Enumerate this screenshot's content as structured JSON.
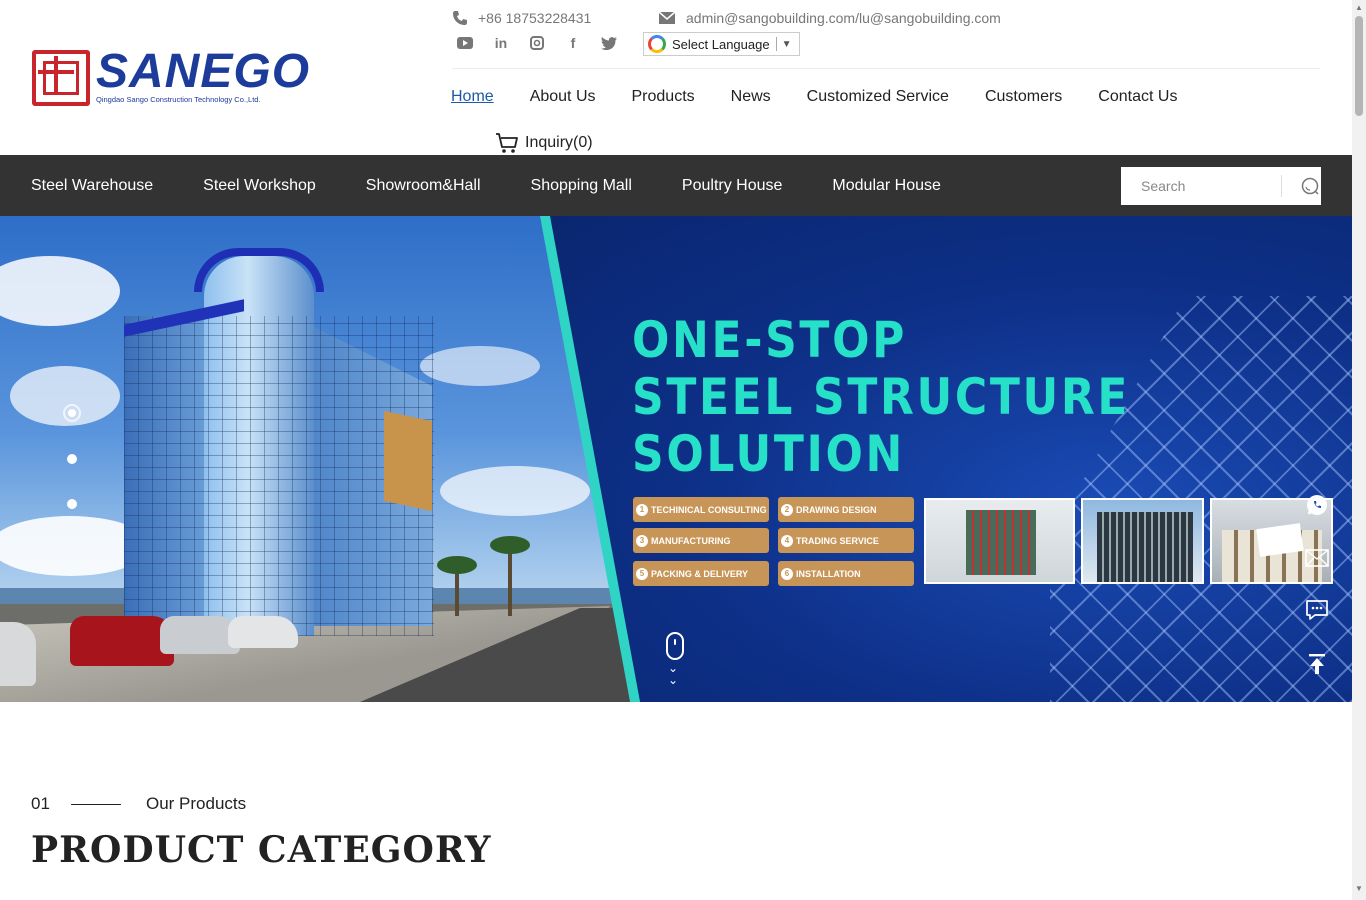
{
  "header": {
    "logo_word": "SANEGO",
    "logo_subtitle": "Qingdao Sango Construction Technology Co.,Ltd.",
    "phone": "+86 18753228431",
    "email": "admin@sangobuilding.com/lu@sangobuilding.com",
    "social_icons": [
      "youtube-icon",
      "linkedin-icon",
      "instagram-icon",
      "facebook-icon",
      "twitter-icon"
    ],
    "language_select": "Select Language",
    "nav": [
      "Home",
      "About Us",
      "Products",
      "News",
      "Customized Service",
      "Customers",
      "Contact Us"
    ],
    "active_nav": "Home",
    "inquiry": "Inquiry(0)"
  },
  "category_bar": {
    "items": [
      "Steel Warehouse",
      "Steel Workshop",
      "Showroom&Hall",
      "Shopping Mall",
      "Poultry House",
      "Modular House"
    ],
    "search_placeholder": "Search"
  },
  "banner": {
    "headline": [
      "ONE-STOP",
      "STEEL STRUCTURE",
      "SOLUTION"
    ],
    "services": [
      {
        "num": "1",
        "label": "TECHINICAL CONSULTING"
      },
      {
        "num": "2",
        "label": "DRAWING DESIGN"
      },
      {
        "num": "3",
        "label": "MANUFACTURING"
      },
      {
        "num": "4",
        "label": "TRADING SERVICE"
      },
      {
        "num": "5",
        "label": "PACKING & DELIVERY"
      },
      {
        "num": "6",
        "label": "INSTALLATION"
      }
    ],
    "slide_count": 3,
    "active_slide": 1
  },
  "side_tools": [
    "whatsapp-icon",
    "email-icon",
    "message-icon",
    "back-to-top-icon"
  ],
  "products_section": {
    "number": "01",
    "label": "Our Products",
    "title": "PRODUCT CATEGORY"
  },
  "colors": {
    "brand_blue": "#1d3b9a",
    "brand_red": "#c8262c",
    "category_bar": "#333333",
    "headline_teal": "#26e0c8",
    "service_gold": "#c89558",
    "active_link": "#1b5aa6"
  }
}
